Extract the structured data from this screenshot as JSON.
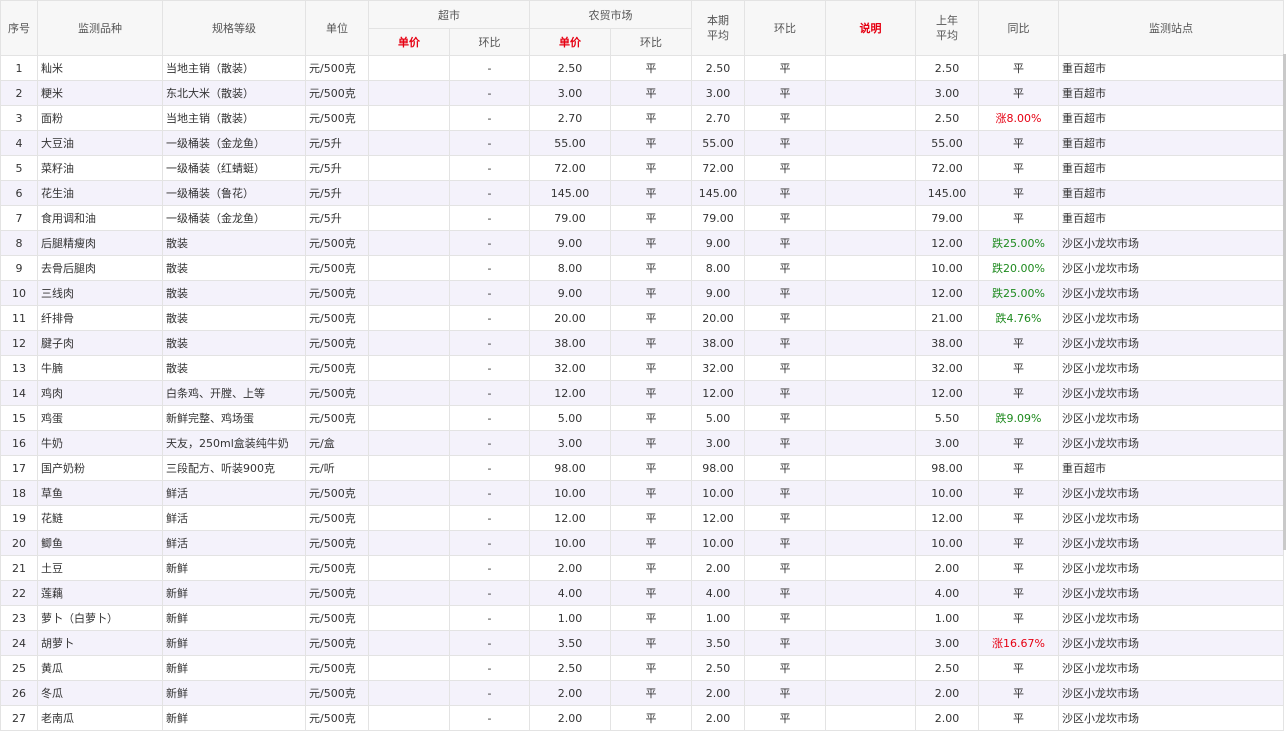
{
  "header": {
    "seq": "序号",
    "item": "监测品种",
    "spec": "规格等级",
    "unit": "单位",
    "supermarket": "超市",
    "farmers_market": "农贸市场",
    "period_avg": "本期\n平均",
    "mom": "环比",
    "note": "说明",
    "last_year_avg": "上年\n平均",
    "yoy": "同比",
    "station": "监测站点",
    "sm_price": "单价",
    "sm_mom": "环比",
    "fm_price": "单价",
    "fm_mom": "环比"
  },
  "colors": {
    "accent_red": "#e60012",
    "accent_green": "#1e8a1e",
    "alt_row": "#f4f2fb",
    "header_bg": "#f7f7f7"
  },
  "rows": [
    {
      "seq": "1",
      "item": "籼米",
      "spec": "当地主销（散装）",
      "unit": "元/500克",
      "sm_price": "",
      "sm_mom": "-",
      "fm_price": "2.50",
      "fm_mom": "平",
      "avg": "2.50",
      "mom": "平",
      "note": "",
      "last_avg": "2.50",
      "yoy": "平",
      "yoy_trend": "flat",
      "station": "重百超市"
    },
    {
      "seq": "2",
      "item": "粳米",
      "spec": "东北大米（散装）",
      "unit": "元/500克",
      "sm_price": "",
      "sm_mom": "-",
      "fm_price": "3.00",
      "fm_mom": "平",
      "avg": "3.00",
      "mom": "平",
      "note": "",
      "last_avg": "3.00",
      "yoy": "平",
      "yoy_trend": "flat",
      "station": "重百超市"
    },
    {
      "seq": "3",
      "item": "面粉",
      "spec": "当地主销（散装）",
      "unit": "元/500克",
      "sm_price": "",
      "sm_mom": "-",
      "fm_price": "2.70",
      "fm_mom": "平",
      "avg": "2.70",
      "mom": "平",
      "note": "",
      "last_avg": "2.50",
      "yoy": "涨8.00%",
      "yoy_trend": "up",
      "station": "重百超市"
    },
    {
      "seq": "4",
      "item": "大豆油",
      "spec": "一级桶装（金龙鱼）",
      "unit": "元/5升",
      "sm_price": "",
      "sm_mom": "-",
      "fm_price": "55.00",
      "fm_mom": "平",
      "avg": "55.00",
      "mom": "平",
      "note": "",
      "last_avg": "55.00",
      "yoy": "平",
      "yoy_trend": "flat",
      "station": "重百超市"
    },
    {
      "seq": "5",
      "item": "菜籽油",
      "spec": "一级桶装（红蜻蜓）",
      "unit": "元/5升",
      "sm_price": "",
      "sm_mom": "-",
      "fm_price": "72.00",
      "fm_mom": "平",
      "avg": "72.00",
      "mom": "平",
      "note": "",
      "last_avg": "72.00",
      "yoy": "平",
      "yoy_trend": "flat",
      "station": "重百超市"
    },
    {
      "seq": "6",
      "item": "花生油",
      "spec": "一级桶装（鲁花）",
      "unit": "元/5升",
      "sm_price": "",
      "sm_mom": "-",
      "fm_price": "145.00",
      "fm_mom": "平",
      "avg": "145.00",
      "mom": "平",
      "note": "",
      "last_avg": "145.00",
      "yoy": "平",
      "yoy_trend": "flat",
      "station": "重百超市"
    },
    {
      "seq": "7",
      "item": "食用调和油",
      "spec": "一级桶装（金龙鱼）",
      "unit": "元/5升",
      "sm_price": "",
      "sm_mom": "-",
      "fm_price": "79.00",
      "fm_mom": "平",
      "avg": "79.00",
      "mom": "平",
      "note": "",
      "last_avg": "79.00",
      "yoy": "平",
      "yoy_trend": "flat",
      "station": "重百超市"
    },
    {
      "seq": "8",
      "item": "后腿精瘦肉",
      "spec": "散装",
      "unit": "元/500克",
      "sm_price": "",
      "sm_mom": "-",
      "fm_price": "9.00",
      "fm_mom": "平",
      "avg": "9.00",
      "mom": "平",
      "note": "",
      "last_avg": "12.00",
      "yoy": "跌25.00%",
      "yoy_trend": "down",
      "station": "沙区小龙坎市场"
    },
    {
      "seq": "9",
      "item": "去骨后腿肉",
      "spec": "散装",
      "unit": "元/500克",
      "sm_price": "",
      "sm_mom": "-",
      "fm_price": "8.00",
      "fm_mom": "平",
      "avg": "8.00",
      "mom": "平",
      "note": "",
      "last_avg": "10.00",
      "yoy": "跌20.00%",
      "yoy_trend": "down",
      "station": "沙区小龙坎市场"
    },
    {
      "seq": "10",
      "item": "三线肉",
      "spec": "散装",
      "unit": "元/500克",
      "sm_price": "",
      "sm_mom": "-",
      "fm_price": "9.00",
      "fm_mom": "平",
      "avg": "9.00",
      "mom": "平",
      "note": "",
      "last_avg": "12.00",
      "yoy": "跌25.00%",
      "yoy_trend": "down",
      "station": "沙区小龙坎市场"
    },
    {
      "seq": "11",
      "item": "纤排骨",
      "spec": "散装",
      "unit": "元/500克",
      "sm_price": "",
      "sm_mom": "-",
      "fm_price": "20.00",
      "fm_mom": "平",
      "avg": "20.00",
      "mom": "平",
      "note": "",
      "last_avg": "21.00",
      "yoy": "跌4.76%",
      "yoy_trend": "down",
      "station": "沙区小龙坎市场"
    },
    {
      "seq": "12",
      "item": "腱子肉",
      "spec": "散装",
      "unit": "元/500克",
      "sm_price": "",
      "sm_mom": "-",
      "fm_price": "38.00",
      "fm_mom": "平",
      "avg": "38.00",
      "mom": "平",
      "note": "",
      "last_avg": "38.00",
      "yoy": "平",
      "yoy_trend": "flat",
      "station": "沙区小龙坎市场"
    },
    {
      "seq": "13",
      "item": "牛腩",
      "spec": "散装",
      "unit": "元/500克",
      "sm_price": "",
      "sm_mom": "-",
      "fm_price": "32.00",
      "fm_mom": "平",
      "avg": "32.00",
      "mom": "平",
      "note": "",
      "last_avg": "32.00",
      "yoy": "平",
      "yoy_trend": "flat",
      "station": "沙区小龙坎市场"
    },
    {
      "seq": "14",
      "item": "鸡肉",
      "spec": "白条鸡、开膛、上等",
      "unit": "元/500克",
      "sm_price": "",
      "sm_mom": "-",
      "fm_price": "12.00",
      "fm_mom": "平",
      "avg": "12.00",
      "mom": "平",
      "note": "",
      "last_avg": "12.00",
      "yoy": "平",
      "yoy_trend": "flat",
      "station": "沙区小龙坎市场"
    },
    {
      "seq": "15",
      "item": "鸡蛋",
      "spec": "新鲜完整、鸡场蛋",
      "unit": "元/500克",
      "sm_price": "",
      "sm_mom": "-",
      "fm_price": "5.00",
      "fm_mom": "平",
      "avg": "5.00",
      "mom": "平",
      "note": "",
      "last_avg": "5.50",
      "yoy": "跌9.09%",
      "yoy_trend": "down",
      "station": "沙区小龙坎市场"
    },
    {
      "seq": "16",
      "item": "牛奶",
      "spec": "天友，250ml盒装纯牛奶",
      "unit": "元/盒",
      "sm_price": "",
      "sm_mom": "-",
      "fm_price": "3.00",
      "fm_mom": "平",
      "avg": "3.00",
      "mom": "平",
      "note": "",
      "last_avg": "3.00",
      "yoy": "平",
      "yoy_trend": "flat",
      "station": "沙区小龙坎市场"
    },
    {
      "seq": "17",
      "item": "国产奶粉",
      "spec": "三段配方、听装900克",
      "unit": "元/听",
      "sm_price": "",
      "sm_mom": "-",
      "fm_price": "98.00",
      "fm_mom": "平",
      "avg": "98.00",
      "mom": "平",
      "note": "",
      "last_avg": "98.00",
      "yoy": "平",
      "yoy_trend": "flat",
      "station": "重百超市"
    },
    {
      "seq": "18",
      "item": "草鱼",
      "spec": "鲜活",
      "unit": "元/500克",
      "sm_price": "",
      "sm_mom": "-",
      "fm_price": "10.00",
      "fm_mom": "平",
      "avg": "10.00",
      "mom": "平",
      "note": "",
      "last_avg": "10.00",
      "yoy": "平",
      "yoy_trend": "flat",
      "station": "沙区小龙坎市场"
    },
    {
      "seq": "19",
      "item": "花鲢",
      "spec": "鲜活",
      "unit": "元/500克",
      "sm_price": "",
      "sm_mom": "-",
      "fm_price": "12.00",
      "fm_mom": "平",
      "avg": "12.00",
      "mom": "平",
      "note": "",
      "last_avg": "12.00",
      "yoy": "平",
      "yoy_trend": "flat",
      "station": "沙区小龙坎市场"
    },
    {
      "seq": "20",
      "item": "鲫鱼",
      "spec": "鲜活",
      "unit": "元/500克",
      "sm_price": "",
      "sm_mom": "-",
      "fm_price": "10.00",
      "fm_mom": "平",
      "avg": "10.00",
      "mom": "平",
      "note": "",
      "last_avg": "10.00",
      "yoy": "平",
      "yoy_trend": "flat",
      "station": "沙区小龙坎市场"
    },
    {
      "seq": "21",
      "item": "土豆",
      "spec": "新鲜",
      "unit": "元/500克",
      "sm_price": "",
      "sm_mom": "-",
      "fm_price": "2.00",
      "fm_mom": "平",
      "avg": "2.00",
      "mom": "平",
      "note": "",
      "last_avg": "2.00",
      "yoy": "平",
      "yoy_trend": "flat",
      "station": "沙区小龙坎市场"
    },
    {
      "seq": "22",
      "item": "莲藕",
      "spec": "新鲜",
      "unit": "元/500克",
      "sm_price": "",
      "sm_mom": "-",
      "fm_price": "4.00",
      "fm_mom": "平",
      "avg": "4.00",
      "mom": "平",
      "note": "",
      "last_avg": "4.00",
      "yoy": "平",
      "yoy_trend": "flat",
      "station": "沙区小龙坎市场"
    },
    {
      "seq": "23",
      "item": "萝卜（白萝卜）",
      "spec": "新鲜",
      "unit": "元/500克",
      "sm_price": "",
      "sm_mom": "-",
      "fm_price": "1.00",
      "fm_mom": "平",
      "avg": "1.00",
      "mom": "平",
      "note": "",
      "last_avg": "1.00",
      "yoy": "平",
      "yoy_trend": "flat",
      "station": "沙区小龙坎市场"
    },
    {
      "seq": "24",
      "item": "胡萝卜",
      "spec": "新鲜",
      "unit": "元/500克",
      "sm_price": "",
      "sm_mom": "-",
      "fm_price": "3.50",
      "fm_mom": "平",
      "avg": "3.50",
      "mom": "平",
      "note": "",
      "last_avg": "3.00",
      "yoy": "涨16.67%",
      "yoy_trend": "up",
      "station": "沙区小龙坎市场"
    },
    {
      "seq": "25",
      "item": "黄瓜",
      "spec": "新鲜",
      "unit": "元/500克",
      "sm_price": "",
      "sm_mom": "-",
      "fm_price": "2.50",
      "fm_mom": "平",
      "avg": "2.50",
      "mom": "平",
      "note": "",
      "last_avg": "2.50",
      "yoy": "平",
      "yoy_trend": "flat",
      "station": "沙区小龙坎市场"
    },
    {
      "seq": "26",
      "item": "冬瓜",
      "spec": "新鲜",
      "unit": "元/500克",
      "sm_price": "",
      "sm_mom": "-",
      "fm_price": "2.00",
      "fm_mom": "平",
      "avg": "2.00",
      "mom": "平",
      "note": "",
      "last_avg": "2.00",
      "yoy": "平",
      "yoy_trend": "flat",
      "station": "沙区小龙坎市场"
    },
    {
      "seq": "27",
      "item": "老南瓜",
      "spec": "新鲜",
      "unit": "元/500克",
      "sm_price": "",
      "sm_mom": "-",
      "fm_price": "2.00",
      "fm_mom": "平",
      "avg": "2.00",
      "mom": "平",
      "note": "",
      "last_avg": "2.00",
      "yoy": "平",
      "yoy_trend": "flat",
      "station": "沙区小龙坎市场"
    }
  ]
}
